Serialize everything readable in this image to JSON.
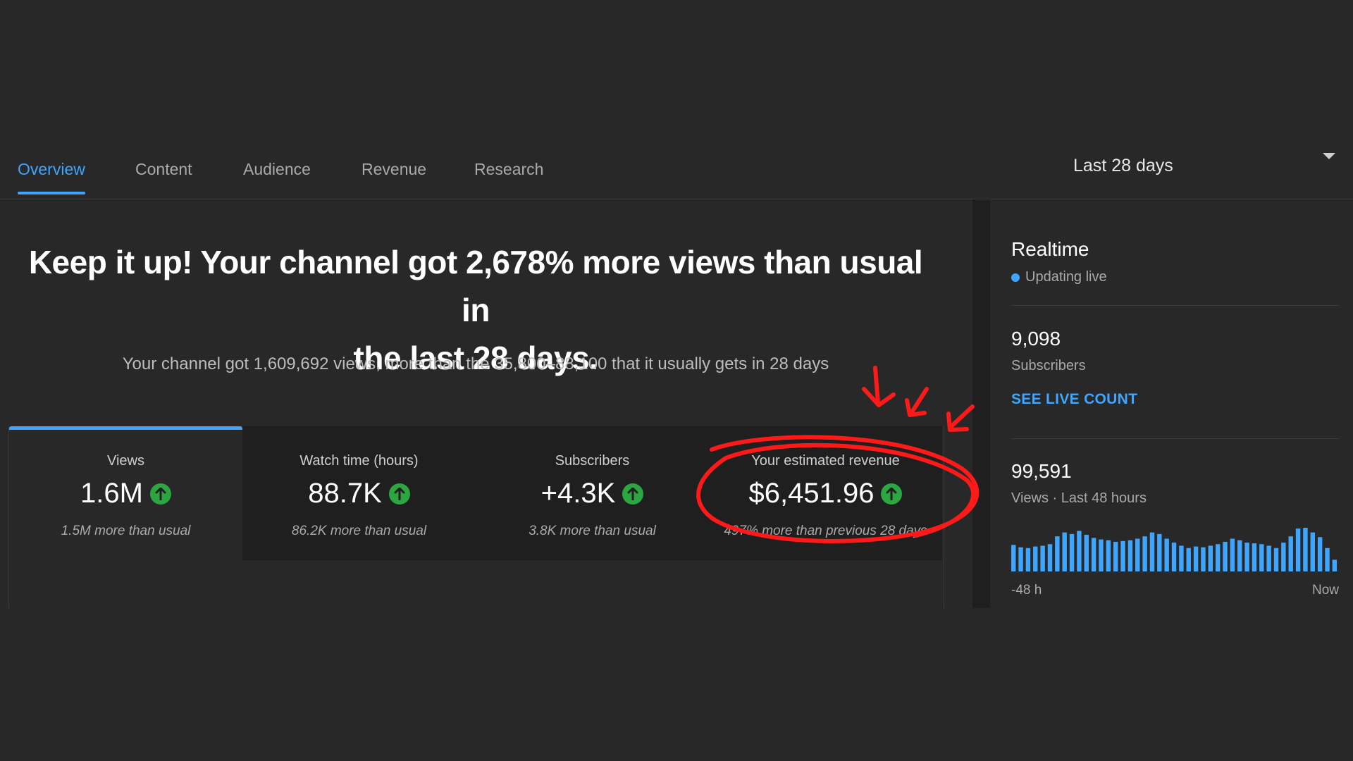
{
  "tabs": [
    {
      "label": "Overview",
      "active": true
    },
    {
      "label": "Content"
    },
    {
      "label": "Audience"
    },
    {
      "label": "Revenue"
    },
    {
      "label": "Research"
    }
  ],
  "date_range": {
    "selected": "Last 28 days"
  },
  "headline": {
    "line1": "Keep it up! Your channel got 2,678% more views than usual in",
    "line2": "the last 28 days.",
    "subtext": "Your channel got 1,609,692 views, more than the 35,800–88,100 that it usually gets in 28 days"
  },
  "metrics": [
    {
      "label": "Views",
      "value": "1.6M",
      "note": "1.5M more than usual"
    },
    {
      "label": "Watch time (hours)",
      "value": "88.7K",
      "note": "86.2K more than usual"
    },
    {
      "label": "Subscribers",
      "value": "+4.3K",
      "note": "3.8K more than usual"
    },
    {
      "label": "Your estimated revenue",
      "value": "$6,451.96",
      "note": "497% more than previous 28 days"
    }
  ],
  "realtime": {
    "title": "Realtime",
    "status": "Updating live",
    "subscribers_value": "9,098",
    "subscribers_label": "Subscribers",
    "live_count_link": "SEE LIVE COUNT",
    "views_value": "99,591",
    "views_label": "Views · Last 48 hours",
    "axis_start": "-48 h",
    "axis_end": "Now",
    "hourly_views": [
      34,
      31,
      30,
      32,
      33,
      35,
      45,
      50,
      48,
      52,
      47,
      43,
      41,
      40,
      38,
      39,
      40,
      42,
      45,
      50,
      48,
      42,
      37,
      33,
      30,
      32,
      31,
      33,
      35,
      38,
      42,
      40,
      37,
      36,
      35,
      33,
      30,
      37,
      45,
      55,
      56,
      50,
      44,
      30,
      15
    ],
    "bar_color": "#3ea6ff"
  },
  "colors": {
    "accent": "#3ea6ff",
    "positive": "#2ba640",
    "annotation": "#ff1a1a"
  }
}
